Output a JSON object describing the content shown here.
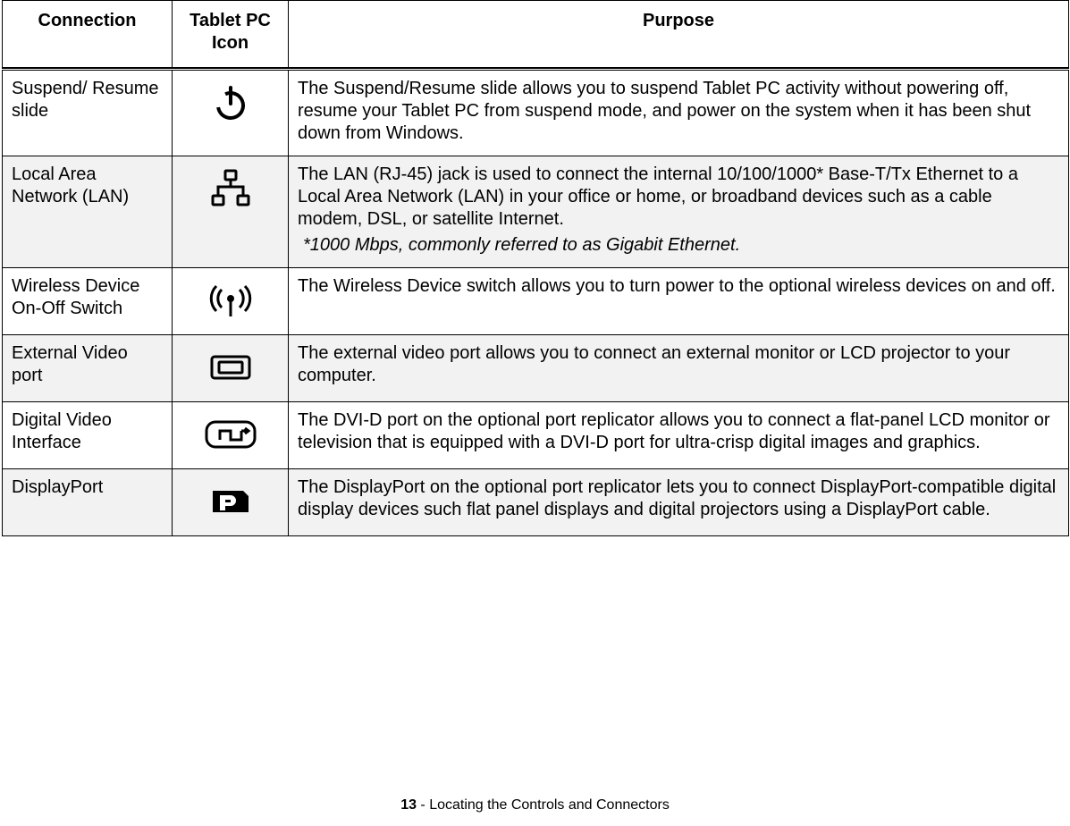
{
  "headers": {
    "connection": "Connection",
    "icon": "Tablet PC Icon",
    "purpose": "Purpose"
  },
  "rows": [
    {
      "connection": "Suspend/ Resume slide",
      "icon_name": "power-icon",
      "purpose_main": "The Suspend/Resume slide allows you to suspend Tablet PC activity without powering off, resume your Tablet PC from suspend mode, and power on the system when it has been shut down from Windows.",
      "purpose_note": "",
      "shaded": false
    },
    {
      "connection": "Local Area Network (LAN)",
      "icon_name": "lan-icon",
      "purpose_main": "The LAN (RJ-45) jack is used to connect the internal 10/100/1000* Base-T/Tx Ethernet to a Local Area Network (LAN) in your office or home, or broadband devices such as a cable modem, DSL, or satellite Internet.",
      "purpose_note": "*1000 Mbps, commonly referred to as Gigabit Ethernet.",
      "shaded": true
    },
    {
      "connection": "Wireless Device On-Off Switch",
      "icon_name": "wireless-icon",
      "purpose_main": "The Wireless Device switch allows you to turn power to the optional wireless devices on and off.",
      "purpose_note": "",
      "shaded": false
    },
    {
      "connection": "External Video port",
      "icon_name": "external-video-icon",
      "purpose_main": "The external video port allows you to connect an external monitor or LCD projector to your computer.",
      "purpose_note": "",
      "shaded": true
    },
    {
      "connection": "Digital Video Interface",
      "icon_name": "dvi-icon",
      "purpose_main": "The DVI-D port on the optional port replicator allows you to connect a flat-panel LCD monitor or television that is equipped with a DVI-D port for ultra-crisp digital images and graphics.",
      "purpose_note": "",
      "shaded": false
    },
    {
      "connection": "DisplayPort",
      "icon_name": "displayport-icon",
      "purpose_main": "The DisplayPort on the optional port replicator lets you to connect DisplayPort-compatible digital display devices such flat panel displays and digital projectors using a DisplayPort cable.",
      "purpose_note": "",
      "shaded": true
    }
  ],
  "footer": {
    "page_number": "13",
    "separator": " - ",
    "section": "Locating the Controls and Connectors"
  }
}
